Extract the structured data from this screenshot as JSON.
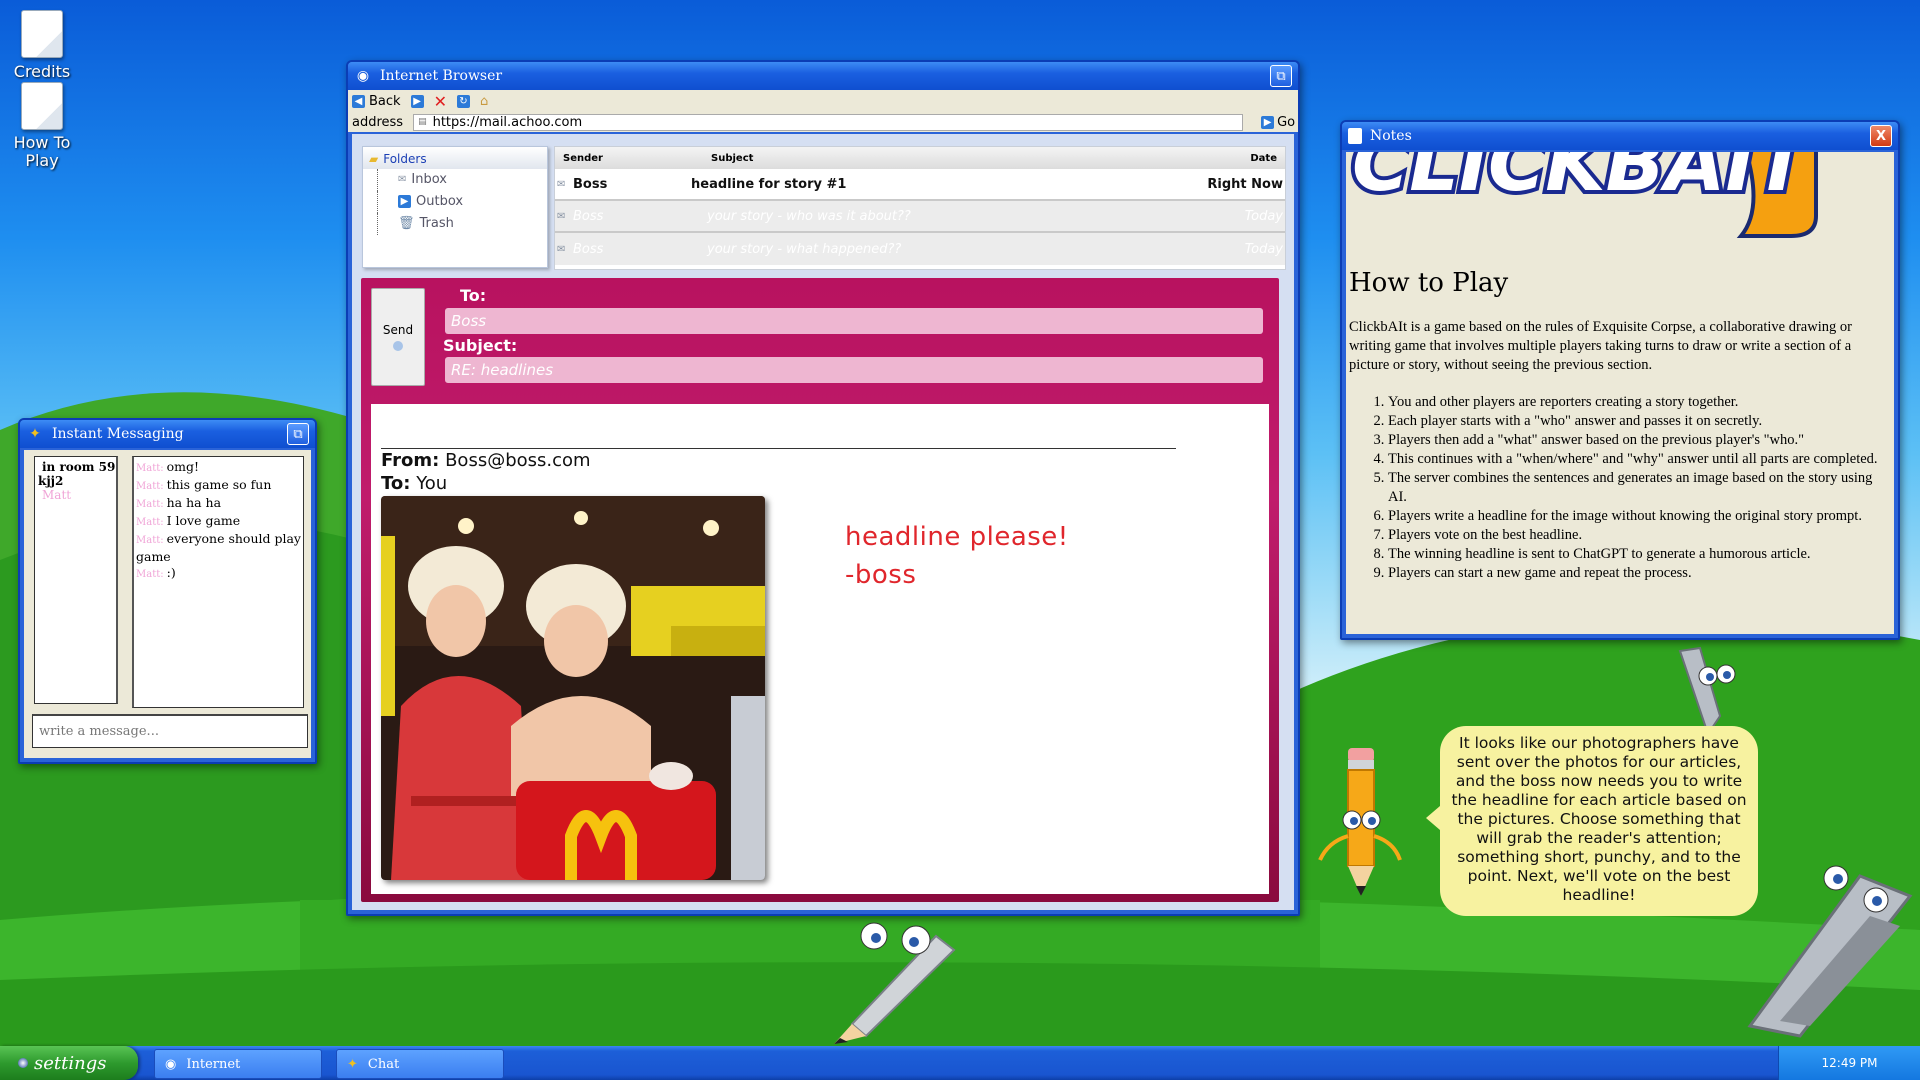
{
  "desktop": {
    "icons": [
      {
        "label": "Credits"
      },
      {
        "label": "How To Play"
      }
    ]
  },
  "browser": {
    "title": "Internet Browser",
    "toolbar": {
      "back": "Back"
    },
    "address_label": "address",
    "url": "https://mail.achoo.com",
    "go": "Go",
    "folders": {
      "header": "Folders",
      "items": [
        "Inbox",
        "Outbox",
        "Trash"
      ]
    },
    "maillist": {
      "headers": {
        "sender": "Sender",
        "subject": "Subject",
        "date": "Date"
      },
      "rows": [
        {
          "sender": "Boss",
          "subject": "headline for story #1",
          "date": "Right Now",
          "status": "unread"
        },
        {
          "sender": "Boss",
          "subject": "your story - who was it about??",
          "date": "Today",
          "status": "read"
        },
        {
          "sender": "Boss",
          "subject": "your story - what happened??",
          "date": "Today",
          "status": "read"
        }
      ]
    },
    "compose": {
      "send": "Send",
      "to_label": "To:",
      "to_value": "Boss",
      "subject_label": "Subject:",
      "subject_value": "RE: headlines"
    },
    "message": {
      "from_label": "From:",
      "from_value": "Boss@boss.com",
      "to_label": "To:",
      "to_value": "You",
      "note_line1": "headline please!",
      "note_line2": "-boss"
    }
  },
  "im": {
    "title": "Instant Messaging",
    "roster": {
      "room": "in room 59",
      "user": "kjj2",
      "other": "Matt"
    },
    "messages": [
      {
        "nick": "Matt:",
        "text": "omg!"
      },
      {
        "nick": "Matt:",
        "text": "this game so fun"
      },
      {
        "nick": "Matt:",
        "text": "ha ha ha"
      },
      {
        "nick": "Matt:",
        "text": "I love game"
      },
      {
        "nick": "Matt:",
        "text": "everyone should play game"
      },
      {
        "nick": "Matt:",
        "text": ":)"
      }
    ],
    "input_placeholder": "write a message..."
  },
  "notes": {
    "title": "Notes",
    "close": "X",
    "heading": "How to Play",
    "intro": "ClickbAIt is a game based on the rules of Exquisite Corpse, a collaborative drawing or writing game that involves multiple players taking turns to draw or write a section of a picture or story, without seeing the previous section.",
    "steps": [
      "You and other players are reporters creating a story together.",
      "Each player starts with a \"who\" answer and passes it on secretly.",
      "Players then add a \"what\" answer based on the previous player's \"who.\"",
      "This continues with a \"when/where\" and \"why\" answer until all parts are completed.",
      "The server combines the sentences and generates an image based on the story using AI.",
      "Players write a headline for the image without knowing the original story prompt.",
      "Players vote on the best headline.",
      "The winning headline is sent to ChatGPT to generate a humorous article.",
      "Players can start a new game and repeat the process."
    ]
  },
  "assistant": {
    "bubble": "It looks like our photographers have sent over the photos for our articles, and the boss now needs you to write the headline for each article based on the pictures. Choose something that will grab the reader's attention; something short, punchy, and to the point. Next, we'll vote on the best headline!"
  },
  "taskbar": {
    "start": "settings",
    "tasks": [
      "Internet",
      "Chat"
    ],
    "clock": "12:49 PM"
  },
  "colors": {
    "titlebar": "#1a5fe0",
    "compose": "#b8125f",
    "bubble": "#f7f2a0",
    "start": "#2e9a2e",
    "handwriting": "#e0262c"
  }
}
